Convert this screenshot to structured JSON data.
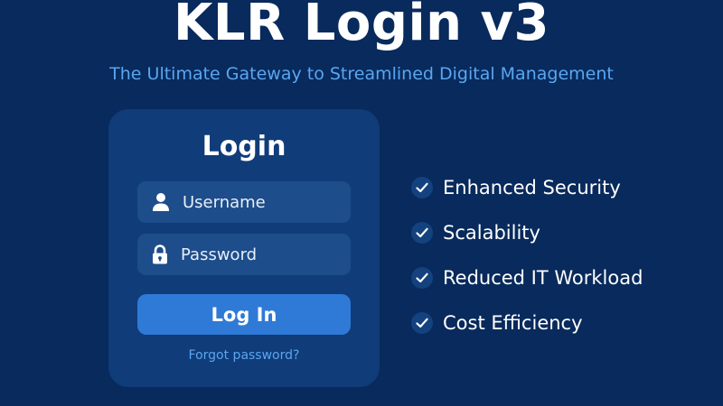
{
  "header": {
    "title": "KLR Login v3",
    "subtitle": "The Ultimate Gateway to Streamlined Digital Management"
  },
  "login_card": {
    "title": "Login",
    "username": {
      "placeholder": "Username",
      "value": "",
      "icon": "user-icon"
    },
    "password": {
      "placeholder": "Password",
      "value": "",
      "icon": "lock-icon"
    },
    "login_button_label": "Log In",
    "forgot_password_label": "Forgot password?"
  },
  "features": [
    {
      "label": "Enhanced Security",
      "icon": "check-icon"
    },
    {
      "label": "Scalability",
      "icon": "check-icon"
    },
    {
      "label": "Reduced IT Workload",
      "icon": "check-icon"
    },
    {
      "label": "Cost Efficiency",
      "icon": "check-icon"
    }
  ],
  "colors": {
    "background": "#082a5c",
    "card": "#103c79",
    "input": "#1d4d8a",
    "button": "#2f7ad6",
    "accent_text": "#5aa6f0"
  }
}
